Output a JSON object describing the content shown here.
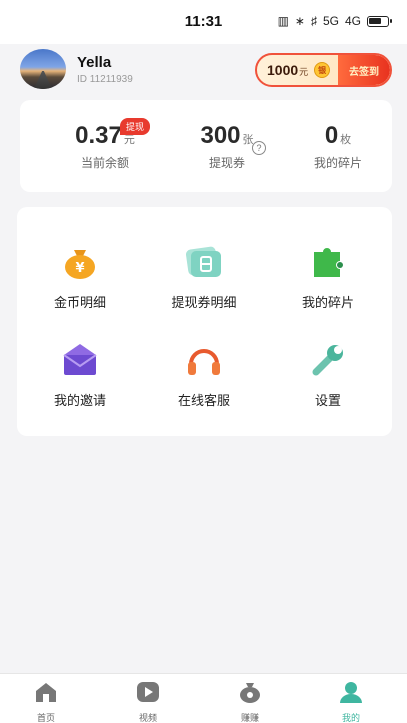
{
  "status_bar": {
    "time": "11:31",
    "signal_5g": "5G",
    "signal_4g": "4G"
  },
  "profile": {
    "username": "Yella",
    "user_id": "ID  11211939"
  },
  "signin": {
    "amount": "1000",
    "unit": "元",
    "coin_label": "银",
    "button_label": "去签到"
  },
  "balance": {
    "stats": [
      {
        "value": "0.37",
        "unit": "元",
        "label": "当前余额"
      },
      {
        "value": "300",
        "unit": "张",
        "label": "提现券"
      },
      {
        "value": "0",
        "unit": "枚",
        "label": "我的碎片"
      }
    ],
    "withdraw_badge": "提现",
    "help_icon": "?"
  },
  "menu": {
    "items": [
      {
        "label": "金币明细",
        "icon": "money-bag-icon",
        "color": "#f5a623"
      },
      {
        "label": "提现券明细",
        "icon": "ticket-icon",
        "color": "#7fd3c2"
      },
      {
        "label": "我的碎片",
        "icon": "puzzle-icon",
        "color": "#3fb84a"
      },
      {
        "label": "我的邀请",
        "icon": "envelope-icon",
        "color": "#6d4ad1"
      },
      {
        "label": "在线客服",
        "icon": "headphones-icon",
        "color": "#e85a2e"
      },
      {
        "label": "设置",
        "icon": "wrench-icon",
        "color": "#4bb59c"
      }
    ]
  },
  "tabbar": {
    "tabs": [
      {
        "label": "首页",
        "icon": "home-icon",
        "active": false
      },
      {
        "label": "视频",
        "icon": "play-icon",
        "active": false
      },
      {
        "label": "赚赚",
        "icon": "coin-bag-icon",
        "active": false
      },
      {
        "label": "我的",
        "icon": "user-icon",
        "active": true
      }
    ]
  },
  "colors": {
    "accent": "#3fb6a0",
    "badge_red": "#e83a2e",
    "background": "#f4f4f6"
  }
}
